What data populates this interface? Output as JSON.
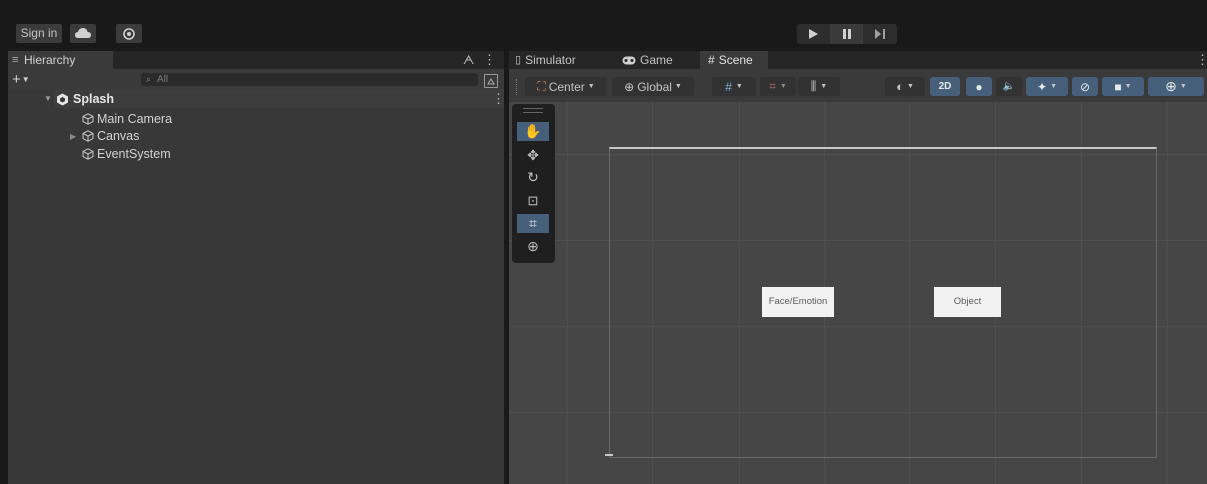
{
  "toolbar": {
    "sign_in": "Sign in"
  },
  "hierarchy": {
    "tab_label": "Hierarchy",
    "search_placeholder": "All",
    "items": [
      {
        "label": "Splash"
      },
      {
        "label": "Main Camera"
      },
      {
        "label": "Canvas"
      },
      {
        "label": "EventSystem"
      }
    ]
  },
  "scene_panel": {
    "tabs": [
      {
        "label": "Simulator"
      },
      {
        "label": "Game"
      },
      {
        "label": "Scene"
      }
    ],
    "pivot_mode": "Center",
    "pivot_rotation": "Global",
    "mode_2d": "2D"
  },
  "scene": {
    "buttons": [
      {
        "label": "Face/Emotion"
      },
      {
        "label": "Object"
      }
    ]
  },
  "colors": {
    "accent": "#46607c",
    "panel": "#383838",
    "scene_bg": "#464646"
  }
}
